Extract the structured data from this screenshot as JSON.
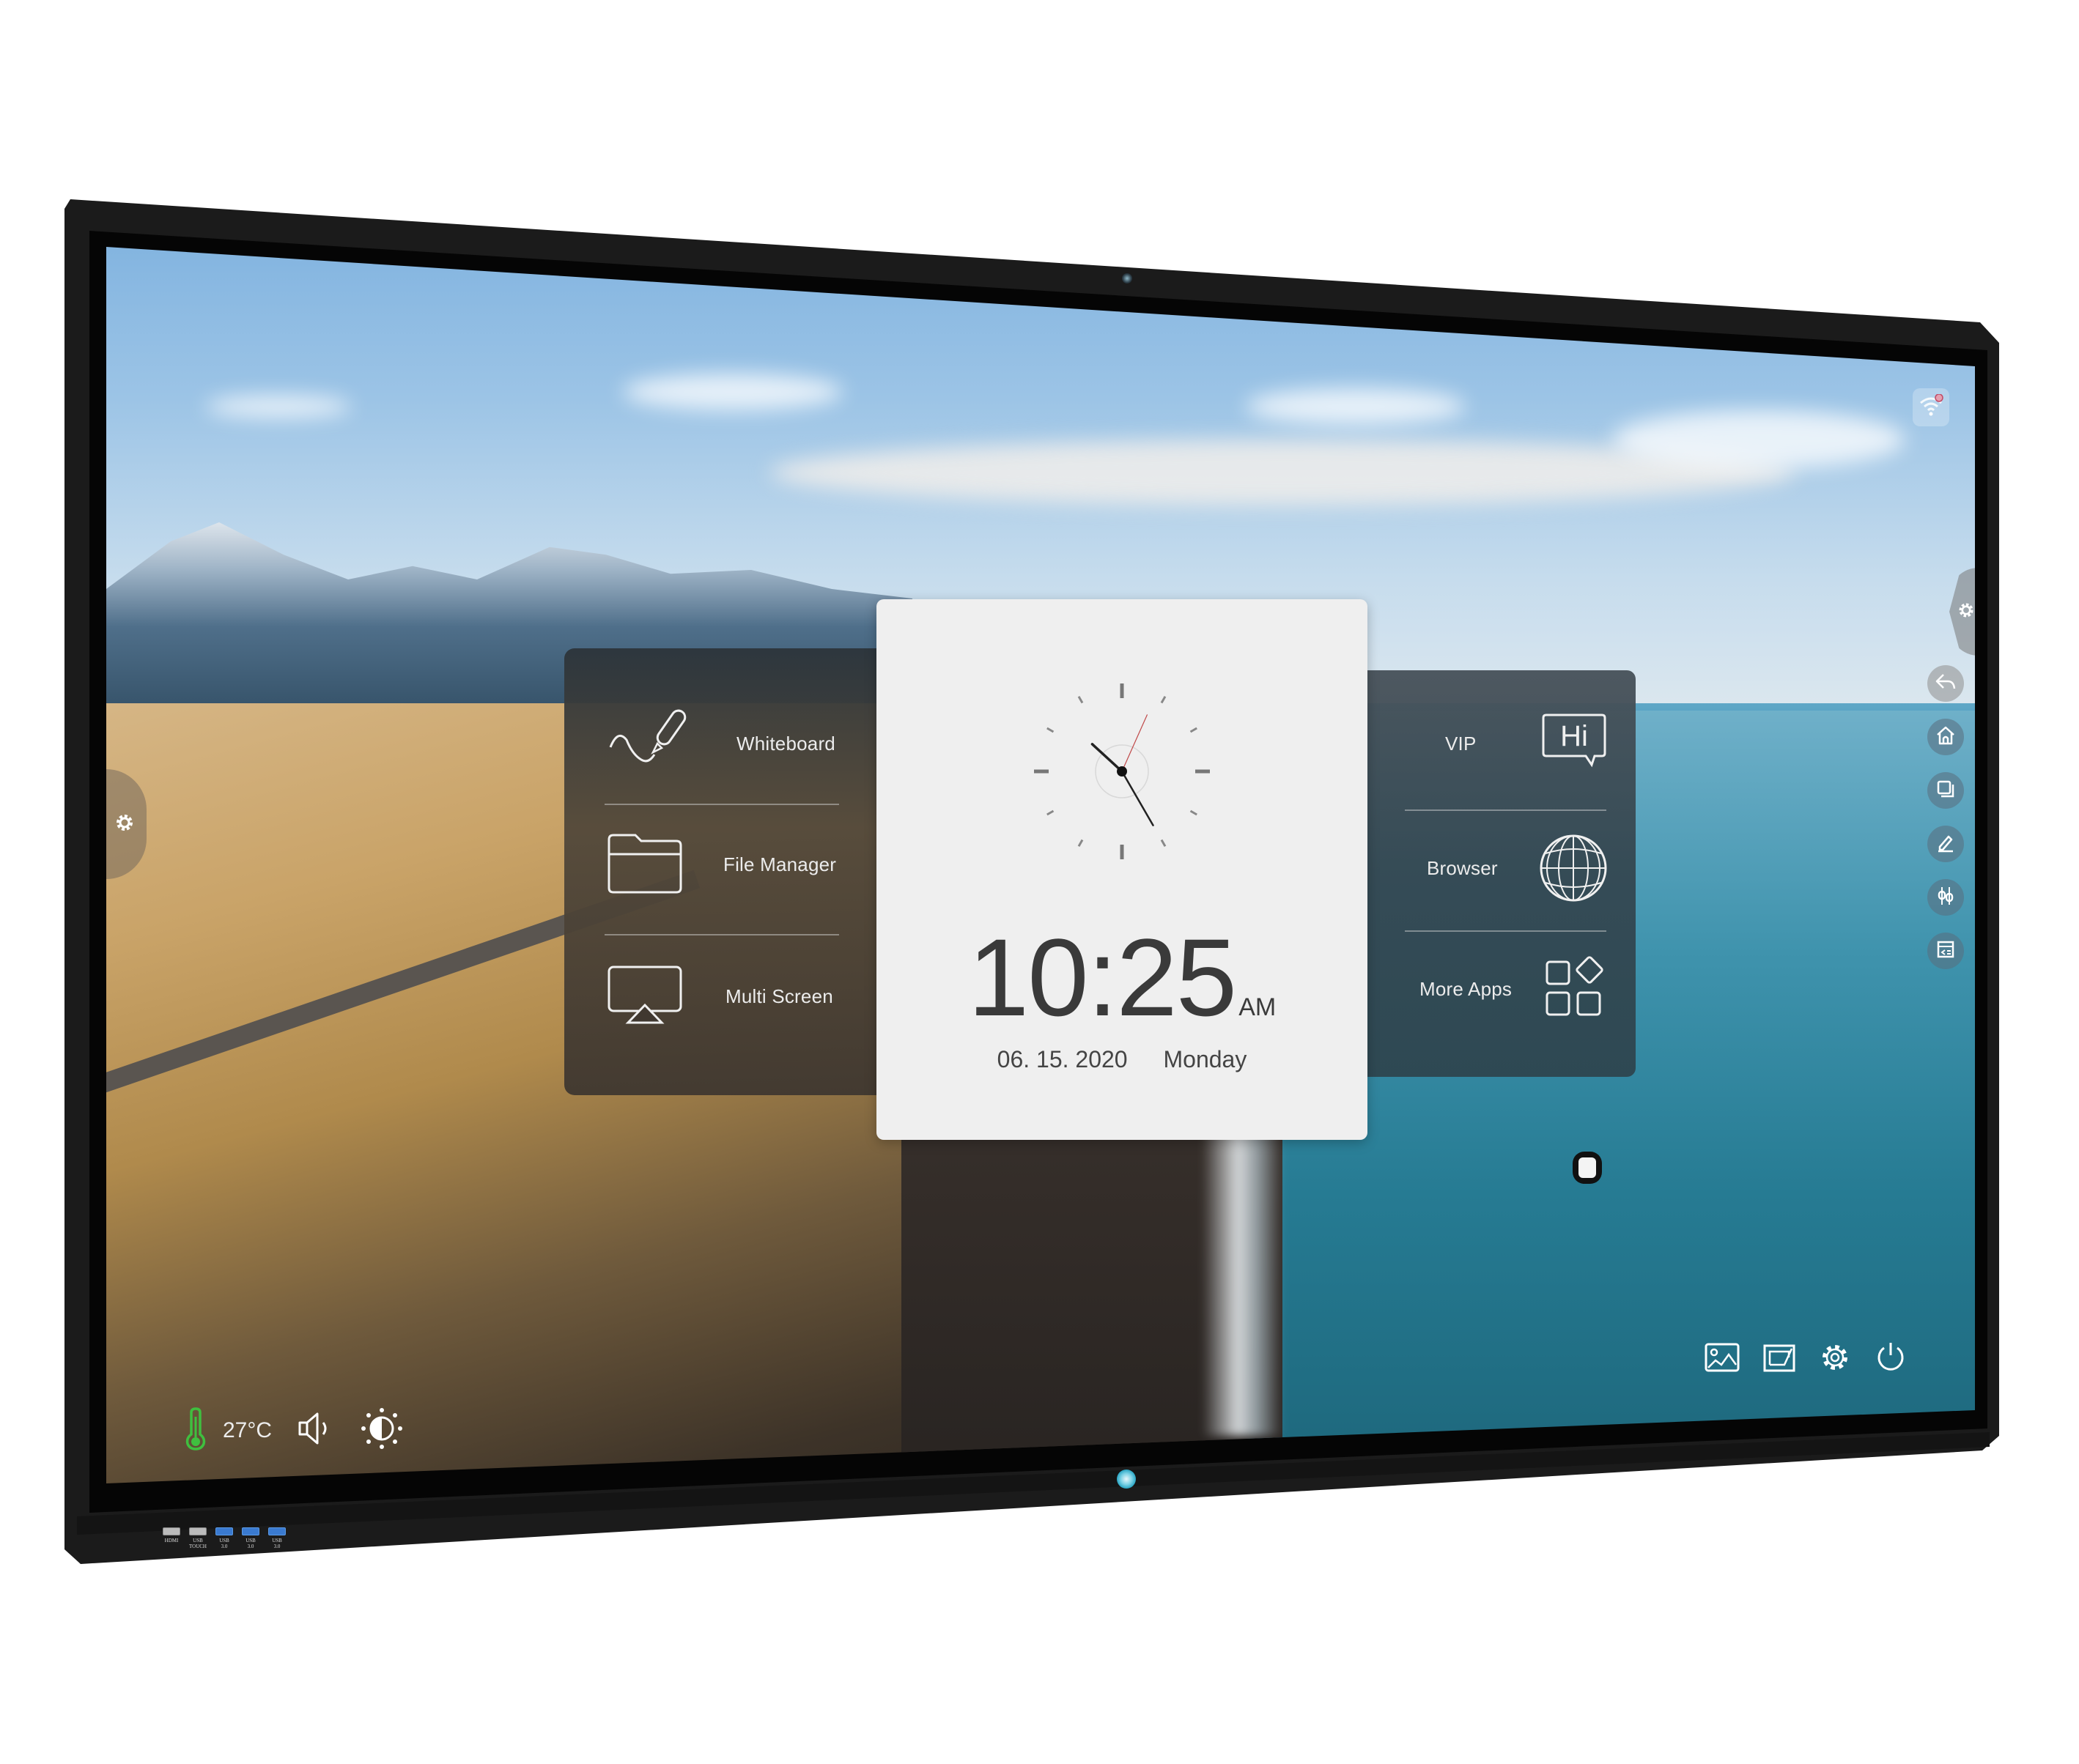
{
  "device": {
    "type": "interactive flat panel display",
    "ports": [
      {
        "label": "HDMI",
        "color": "gray"
      },
      {
        "label": "USB\nTOUCH",
        "color": "gray"
      },
      {
        "label": "USB\n3.0",
        "color": "#3a7ad0"
      },
      {
        "label": "USB\n3.0",
        "color": "#3a7ad0"
      },
      {
        "label": "USB\n3.0",
        "color": "#3a7ad0"
      }
    ]
  },
  "left_panel": {
    "items": [
      {
        "label": "Whiteboard",
        "icon": "marker-pen-icon"
      },
      {
        "label": "File Manager",
        "icon": "folder-icon"
      },
      {
        "label": "Multi Screen",
        "icon": "screen-cast-icon"
      }
    ]
  },
  "clock_widget": {
    "time": "10:25",
    "meridiem": "AM",
    "date": "06. 15. 2020",
    "weekday": "Monday",
    "analog": {
      "hour": 10,
      "minute": 25,
      "second": 4
    }
  },
  "right_panel": {
    "items": [
      {
        "label": "VIP",
        "icon": "hi-speech-bubble-icon"
      },
      {
        "label": "Browser",
        "icon": "globe-icon"
      },
      {
        "label": "More Apps",
        "icon": "app-grid-icon"
      }
    ]
  },
  "right_sidebar": {
    "items": [
      {
        "name": "back",
        "icon": "back-arrow-icon"
      },
      {
        "name": "home",
        "icon": "home-icon"
      },
      {
        "name": "windows",
        "icon": "multitask-icon"
      },
      {
        "name": "annotate",
        "icon": "pencil-icon"
      },
      {
        "name": "tools",
        "icon": "sliders-icon"
      },
      {
        "name": "signal-source",
        "icon": "input-source-icon"
      }
    ]
  },
  "status_bar": {
    "temperature": "27°C",
    "temperature_color": "#3fbf3f",
    "wifi_status": "disconnected"
  },
  "bottom_right_toolbar": {
    "items": [
      {
        "name": "wallpaper",
        "icon": "image-icon"
      },
      {
        "name": "screen-frame",
        "icon": "window-frame-icon"
      },
      {
        "name": "settings",
        "icon": "gear-icon"
      },
      {
        "name": "power",
        "icon": "power-icon"
      }
    ]
  }
}
